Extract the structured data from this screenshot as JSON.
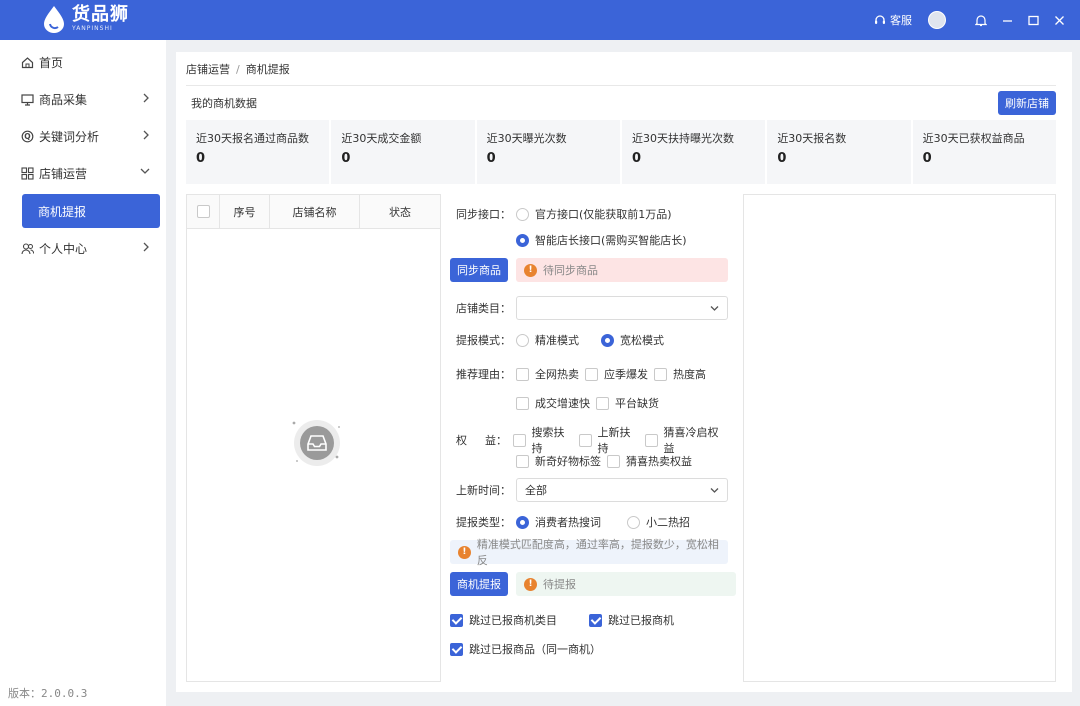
{
  "header": {
    "logo_title": "货品狮",
    "logo_sub": "YANPINSHI",
    "service_label": "客服",
    "accent": "#3b64d8"
  },
  "sidebar": {
    "items": [
      {
        "label": "首页",
        "icon": "home-icon"
      },
      {
        "label": "商品采集",
        "icon": "monitor-icon"
      },
      {
        "label": "关键词分析",
        "icon": "keyword-icon"
      },
      {
        "label": "店铺运营",
        "icon": "grid-icon"
      },
      {
        "label": "个人中心",
        "icon": "user-group-icon"
      }
    ],
    "sub_active": "商机提报",
    "version": "版本：2.0.0.3"
  },
  "breadcrumb": {
    "parent": "店铺运营",
    "sep": "/",
    "current": "商机提报"
  },
  "section": {
    "title": "我的商机数据",
    "refresh_label": "刷新店铺"
  },
  "stats": [
    {
      "label": "近30天报名通过商品数",
      "value": "0"
    },
    {
      "label": "近30天成交金额",
      "value": "0"
    },
    {
      "label": "近30天曝光次数",
      "value": "0"
    },
    {
      "label": "近30天扶持曝光次数",
      "value": "0"
    },
    {
      "label": "近30天报名数",
      "value": "0"
    },
    {
      "label": "近30天已获权益商品",
      "value": "0"
    }
  ],
  "table": {
    "headers": [
      "序号",
      "店铺名称",
      "状态"
    ]
  },
  "form": {
    "sync_api": {
      "label": "同步接口：",
      "options": [
        "官方接口(仅能获取前1万品)",
        "智能店长接口(需购买智能店长)"
      ]
    },
    "sync_button": "同步商品",
    "sync_status": "待同步商品",
    "category": {
      "label": "店铺类目：",
      "value": ""
    },
    "mode": {
      "label": "提报模式：",
      "options": [
        "精准模式",
        "宽松模式"
      ]
    },
    "reason": {
      "label": "推荐理由：",
      "options_row1": [
        "全网热卖",
        "应季爆发",
        "热度高"
      ],
      "options_row2": [
        "成交增速快",
        "平台缺货"
      ]
    },
    "benefit": {
      "label_a": "权",
      "label_b": "益：",
      "options_row1": [
        "搜索扶持",
        "上新扶持",
        "猜喜冷启权益"
      ],
      "options_row2": [
        "新奇好物标签",
        "猜喜热卖权益"
      ]
    },
    "new_time": {
      "label": "上新时间：",
      "value": "全部"
    },
    "report_type": {
      "label": "提报类型：",
      "options": [
        "消费者热搜词",
        "小二热招"
      ]
    },
    "mode_tip": "精准模式匹配度高，通过率高，提报数少，宽松相反",
    "report_button": "商机提报",
    "report_status": "待提报",
    "skip": [
      "跳过已报商机类目",
      "跳过已报商机",
      "跳过已报商品（同一商机）"
    ]
  }
}
